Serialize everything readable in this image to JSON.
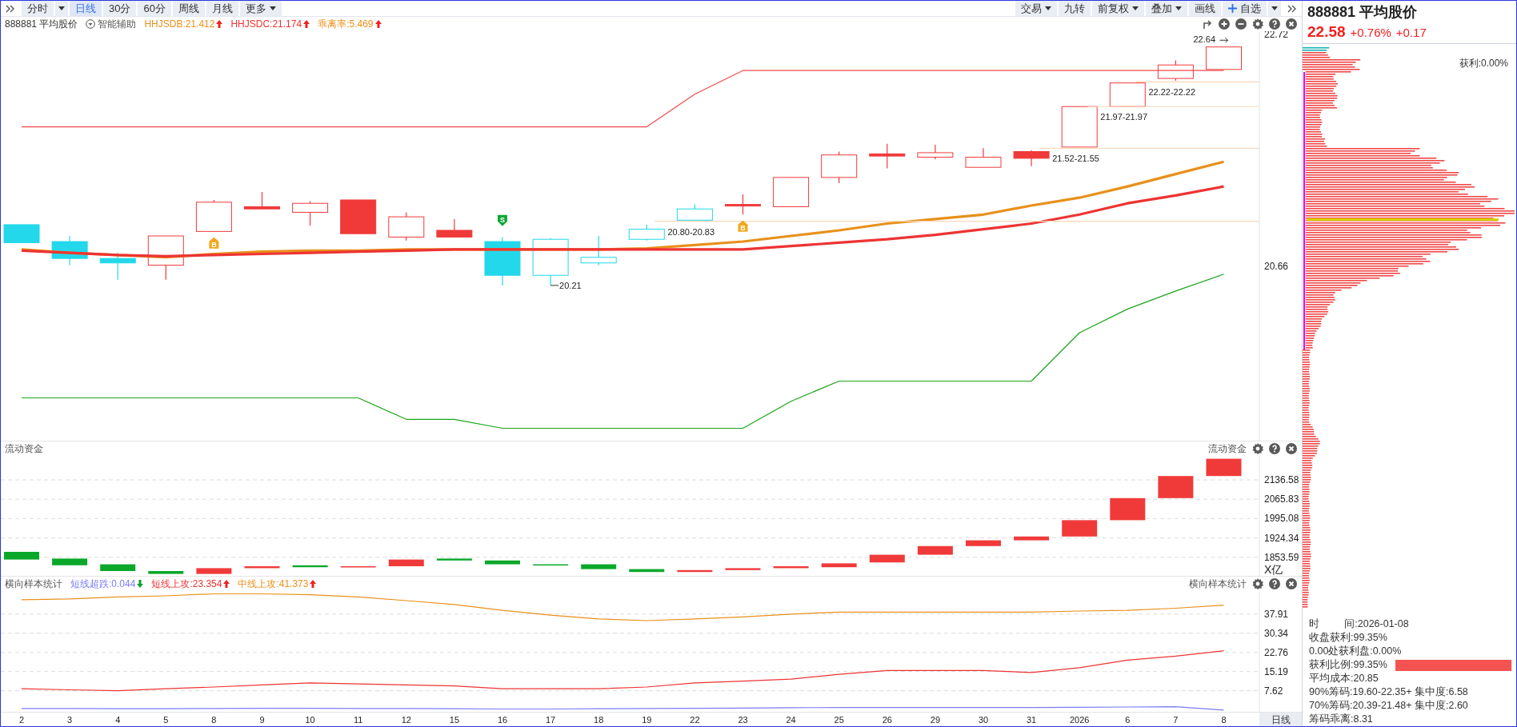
{
  "toolbar": {
    "tabs": [
      {
        "label": "分时",
        "selected": false,
        "dropdown": true,
        "split": true
      },
      {
        "label": "日线",
        "selected": true,
        "dropdown": false
      },
      {
        "label": "30分",
        "selected": false,
        "dropdown": false
      },
      {
        "label": "60分",
        "selected": false,
        "dropdown": false
      },
      {
        "label": "周线",
        "selected": false,
        "dropdown": false
      },
      {
        "label": "月线",
        "selected": false,
        "dropdown": false
      },
      {
        "label": "更多",
        "selected": false,
        "dropdown": true,
        "split": false
      }
    ],
    "buttons": [
      {
        "label": "交易",
        "kind": "plain",
        "dropdown": true,
        "split": false
      },
      {
        "label": "九转",
        "kind": "plain",
        "dropdown": false
      },
      {
        "label": "前复权",
        "kind": "plain",
        "dropdown": true,
        "split": false
      },
      {
        "label": "叠加",
        "kind": "plain",
        "dropdown": true,
        "split": false
      },
      {
        "label": "画线",
        "kind": "plain",
        "dropdown": false
      },
      {
        "label": "自选",
        "kind": "add",
        "dropdown": true,
        "split": true
      }
    ]
  },
  "main_pane": {
    "title": "888881 平均股价",
    "assist_label": "智能辅助",
    "indicators": [
      {
        "text": "HHJSDB:21.412",
        "color": "#e8901a",
        "up": true
      },
      {
        "text": "HHJSDC:21.174",
        "color": "#ee3333",
        "up": true
      },
      {
        "text": "乖离率:5.469",
        "color": "#e8901b",
        "up": true
      }
    ],
    "chart_data": {
      "type": "line",
      "ylim": [
        19.11,
        22.75
      ],
      "yticks": [
        22.72,
        20.66
      ],
      "series": [
        {
          "color": "#f04a4a",
          "values": [
            21.9,
            21.9,
            21.9,
            21.9,
            21.9,
            21.9,
            21.9,
            21.9,
            21.9,
            21.9,
            21.9,
            21.9,
            21.9,
            21.9,
            22.19,
            22.4,
            22.4,
            22.4,
            22.4,
            22.4,
            22.4,
            22.4,
            22.4,
            22.4,
            22.4,
            22.4
          ]
        },
        {
          "color": "#1aa51a",
          "values": [
            19.49,
            19.49,
            19.49,
            19.49,
            19.49,
            19.49,
            19.49,
            19.49,
            19.3,
            19.3,
            19.22,
            19.22,
            19.22,
            19.22,
            19.22,
            19.22,
            19.46,
            19.64,
            19.64,
            19.64,
            19.64,
            19.64,
            20.07,
            20.28,
            20.44,
            20.59
          ]
        },
        {
          "color": "#e8901a",
          "values": [
            20.81,
            20.78,
            20.76,
            20.74,
            20.77,
            20.79,
            20.8,
            20.8,
            20.81,
            20.81,
            20.81,
            20.81,
            20.81,
            20.82,
            20.85,
            20.88,
            20.93,
            20.98,
            21.04,
            21.08,
            21.12,
            21.2,
            21.27,
            21.37,
            21.48,
            21.59
          ]
        },
        {
          "color": "#ee3333",
          "values": [
            20.8,
            20.78,
            20.76,
            20.75,
            20.76,
            20.77,
            20.78,
            20.79,
            20.8,
            20.81,
            20.81,
            20.81,
            20.81,
            20.81,
            20.81,
            20.81,
            20.84,
            20.87,
            20.9,
            20.94,
            20.99,
            21.04,
            21.12,
            21.22,
            21.29,
            21.37
          ]
        }
      ]
    },
    "labels": [
      {
        "kind": "high",
        "text": "22.64"
      },
      {
        "kind": "range",
        "text": "22.22-22.22"
      },
      {
        "kind": "range",
        "text": "21.97-21.97"
      },
      {
        "kind": "range",
        "text": "21.52-21.55"
      },
      {
        "kind": "range",
        "text": "20.80-20.83"
      },
      {
        "kind": "low",
        "text": "20.21"
      },
      {
        "kind": "buy",
        "text": "B"
      },
      {
        "kind": "sell",
        "text": "S"
      },
      {
        "kind": "buy",
        "text": "B"
      }
    ]
  },
  "flow_pane": {
    "title": "流动资金",
    "title_right": "流动资金",
    "axis_labels": [
      "2136.58",
      "2065.83",
      "1995.08",
      "1924.34",
      "1853.59"
    ],
    "unit": "X亿"
  },
  "cross_pane": {
    "title": "横向样本统计",
    "title_right": "横向样本统计",
    "indicators": [
      {
        "text": "短线超跌:0.044",
        "color": "#7b7bf5",
        "up": false
      },
      {
        "text": "短线上攻:23.354",
        "color": "#ee3333",
        "up": true
      },
      {
        "text": "中线上攻:41.373",
        "color": "#e8901a",
        "up": true
      }
    ],
    "chart_data": {
      "type": "line",
      "ylim": [
        -0.7,
        47.0
      ],
      "yticks": [
        37.91,
        30.34,
        22.76,
        15.19,
        7.62
      ],
      "grid": true,
      "series": [
        {
          "color": "#7b7bf5",
          "values": [
            0.6,
            0.6,
            0.5,
            0.5,
            0.6,
            0.7,
            0.7,
            0.6,
            0.6,
            0.5,
            0.4,
            0.4,
            0.5,
            0.6,
            0.7,
            0.8,
            0.9,
            1.0,
            1.0,
            1.0,
            1.0,
            1.0,
            1.1,
            1.2,
            1.3,
            0.0
          ]
        },
        {
          "color": "#ee3333",
          "values": [
            8.4,
            8.0,
            7.6,
            8.4,
            9.1,
            9.9,
            10.7,
            10.3,
            9.9,
            9.5,
            8.4,
            8.4,
            8.4,
            9.1,
            10.7,
            11.4,
            12.2,
            14.1,
            15.6,
            15.6,
            15.6,
            14.8,
            16.7,
            19.7,
            21.3,
            23.4
          ]
        },
        {
          "color": "#e8901a",
          "values": [
            43.6,
            43.9,
            44.7,
            45.1,
            45.9,
            45.9,
            45.5,
            44.7,
            43.2,
            41.7,
            39.4,
            37.5,
            36.0,
            35.3,
            36.0,
            36.8,
            37.9,
            38.7,
            38.7,
            38.7,
            38.7,
            38.7,
            39.1,
            39.4,
            40.2,
            41.4
          ]
        }
      ]
    }
  },
  "date_axis": {
    "labels": [
      "2",
      "3",
      "4",
      "5",
      "8",
      "9",
      "10",
      "11",
      "12",
      "15",
      "16",
      "17",
      "18",
      "19",
      "22",
      "23",
      "24",
      "25",
      "26",
      "29",
      "30",
      "31",
      "2026",
      "6",
      "7",
      "8"
    ],
    "period_label": "日线"
  },
  "quote_panel": {
    "title": "888881 平均股价",
    "price": "22.58",
    "change_pct": "+0.76%",
    "change": "+0.17",
    "profit_label": "获利:0.00%",
    "stats": [
      {
        "kind": "text",
        "text": "时         间:2026-01-08"
      },
      {
        "kind": "text",
        "text": "收盘获利:99.35%"
      },
      {
        "kind": "text",
        "text": "0.00处获利盘:0.00%"
      },
      {
        "kind": "bar",
        "text": "获利比例:99.35%",
        "level": 0.9935
      },
      {
        "kind": "text",
        "text": "平均成本:20.85"
      },
      {
        "kind": "text",
        "text": "90%筹码:19.60-22.35+ 集中度:6.58"
      },
      {
        "kind": "text",
        "text": "70%筹码:20.39-21.48+ 集中度:2.60"
      },
      {
        "kind": "text",
        "text": "筹码乖离:8.31"
      }
    ]
  }
}
